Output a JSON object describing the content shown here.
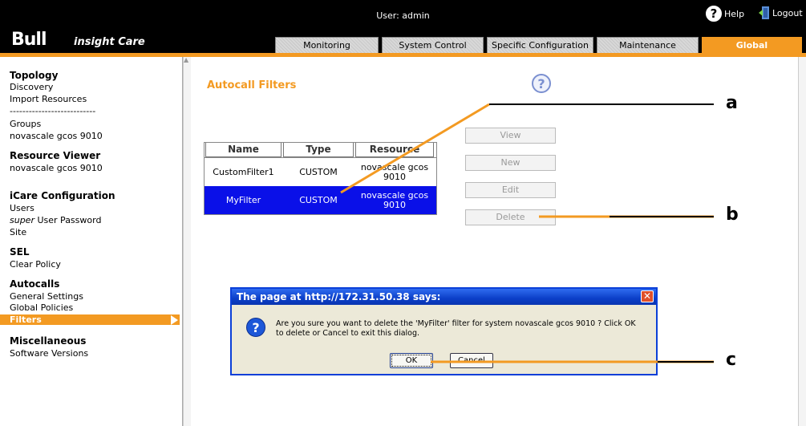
{
  "header": {
    "brand": "Bull",
    "product": "insight Care",
    "user_label": "User: admin",
    "help_label": "Help",
    "logout_label": "Logout"
  },
  "tabs": [
    {
      "label": "Monitoring",
      "active": false
    },
    {
      "label": "System Control",
      "active": false
    },
    {
      "label": "Specific Configuration",
      "active": false
    },
    {
      "label": "Maintenance",
      "active": false
    },
    {
      "label": "Global Configuration",
      "active": true
    }
  ],
  "sidebar": {
    "topology": {
      "title": "Topology",
      "items": [
        "Discovery",
        "Import Resources",
        "---------------------------",
        "Groups",
        "novascale gcos 9010"
      ]
    },
    "resource_viewer": {
      "title": "Resource Viewer",
      "items": [
        "novascale gcos 9010"
      ]
    },
    "icare_config": {
      "title": "iCare Configuration",
      "items": [
        "Users",
        "User Password",
        "Site"
      ],
      "super_prefix": "super"
    },
    "sel": {
      "title": "SEL",
      "items": [
        "Clear Policy"
      ]
    },
    "autocalls": {
      "title": "Autocalls",
      "items": [
        "General Settings",
        "Global Policies",
        "Filters"
      ],
      "active_item": "Filters"
    },
    "misc": {
      "title": "Miscellaneous",
      "items": [
        "Software Versions"
      ]
    }
  },
  "main": {
    "title": "Autocall Filters",
    "help_glyph": "?",
    "table": {
      "headers": [
        "Name",
        "Type",
        "Resource"
      ],
      "rows": [
        {
          "name": "CustomFilter1",
          "type": "CUSTOM",
          "resource": "novascale gcos 9010",
          "selected": false
        },
        {
          "name": "MyFilter",
          "type": "CUSTOM",
          "resource": "novascale gcos 9010",
          "selected": true
        }
      ]
    },
    "buttons": {
      "view": "View",
      "new": "New",
      "edit": "Edit",
      "delete": "Delete"
    }
  },
  "dialog": {
    "title": "The page at http://172.31.50.38 says:",
    "message": "Are you sure you want to delete the 'MyFilter' filter for system novascale gcos 9010 ? Click OK to delete or Cancel to exit this dialog.",
    "ok": "OK",
    "cancel": "Cancel",
    "close_glyph": "✕",
    "icon_glyph": "?"
  },
  "callouts": {
    "a": "a",
    "b": "b",
    "c": "c"
  },
  "colors": {
    "accent": "#f39a22",
    "selection": "#0a10e8",
    "dialog_title": "#0b3fc8"
  }
}
